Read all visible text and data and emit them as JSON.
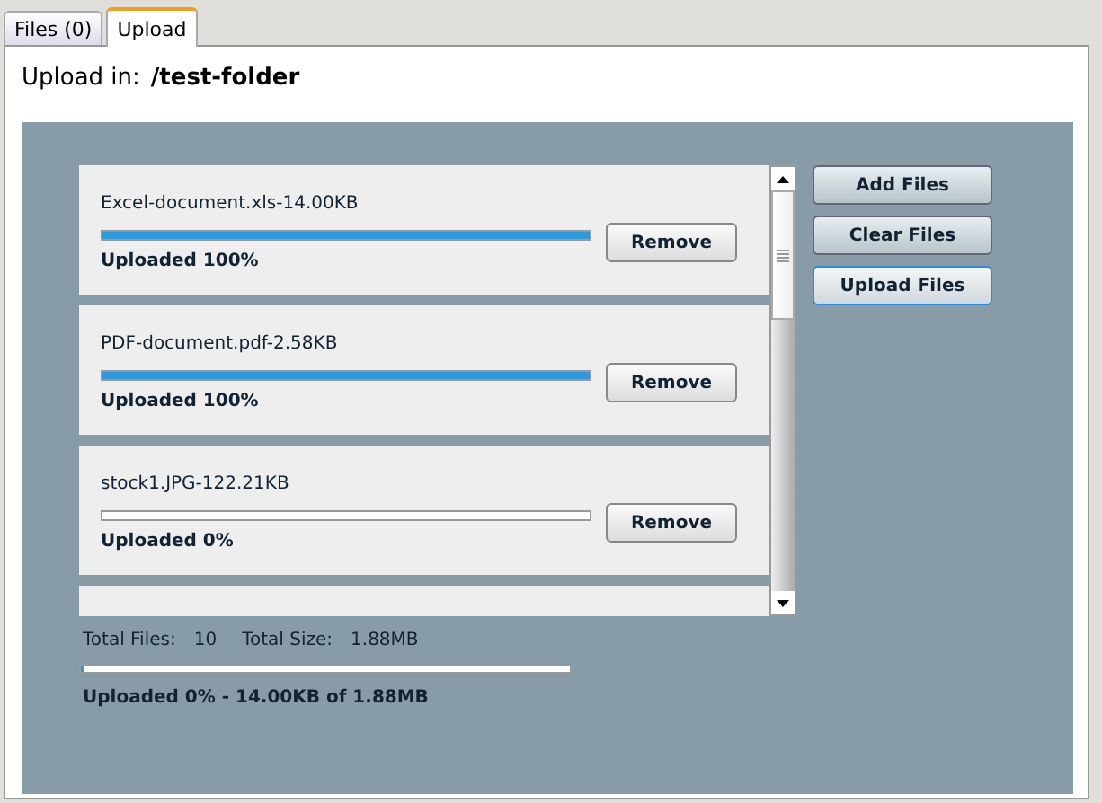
{
  "tabs": [
    {
      "label": "Files (0)",
      "selected": false
    },
    {
      "label": "Upload",
      "selected": true
    }
  ],
  "upload_in": {
    "label": "Upload in:",
    "folder": "/test-folder"
  },
  "files": [
    {
      "name": "Excel-document.xls-14.00KB",
      "level": 1,
      "status": "Uploaded 100%",
      "button": "Remove"
    },
    {
      "name": "PDF-document.pdf-2.58KB",
      "level": 1,
      "status": "Uploaded 100%",
      "button": "Remove"
    },
    {
      "name": "stock1.JPG-122.21KB",
      "level": 0,
      "status": "Uploaded 0%",
      "button": "Remove"
    }
  ],
  "actions": [
    {
      "label": "Add Files",
      "focused": false
    },
    {
      "label": "Clear Files",
      "focused": false
    },
    {
      "label": "Upload Files",
      "focused": true
    }
  ],
  "totals": {
    "files_label": "Total Files:",
    "files_value": "10",
    "size_label": "Total Size:",
    "size_value": "1.88MB"
  },
  "overall": {
    "level": 0.007,
    "status": "Uploaded 0% - 14.00KB of 1.88MB"
  }
}
